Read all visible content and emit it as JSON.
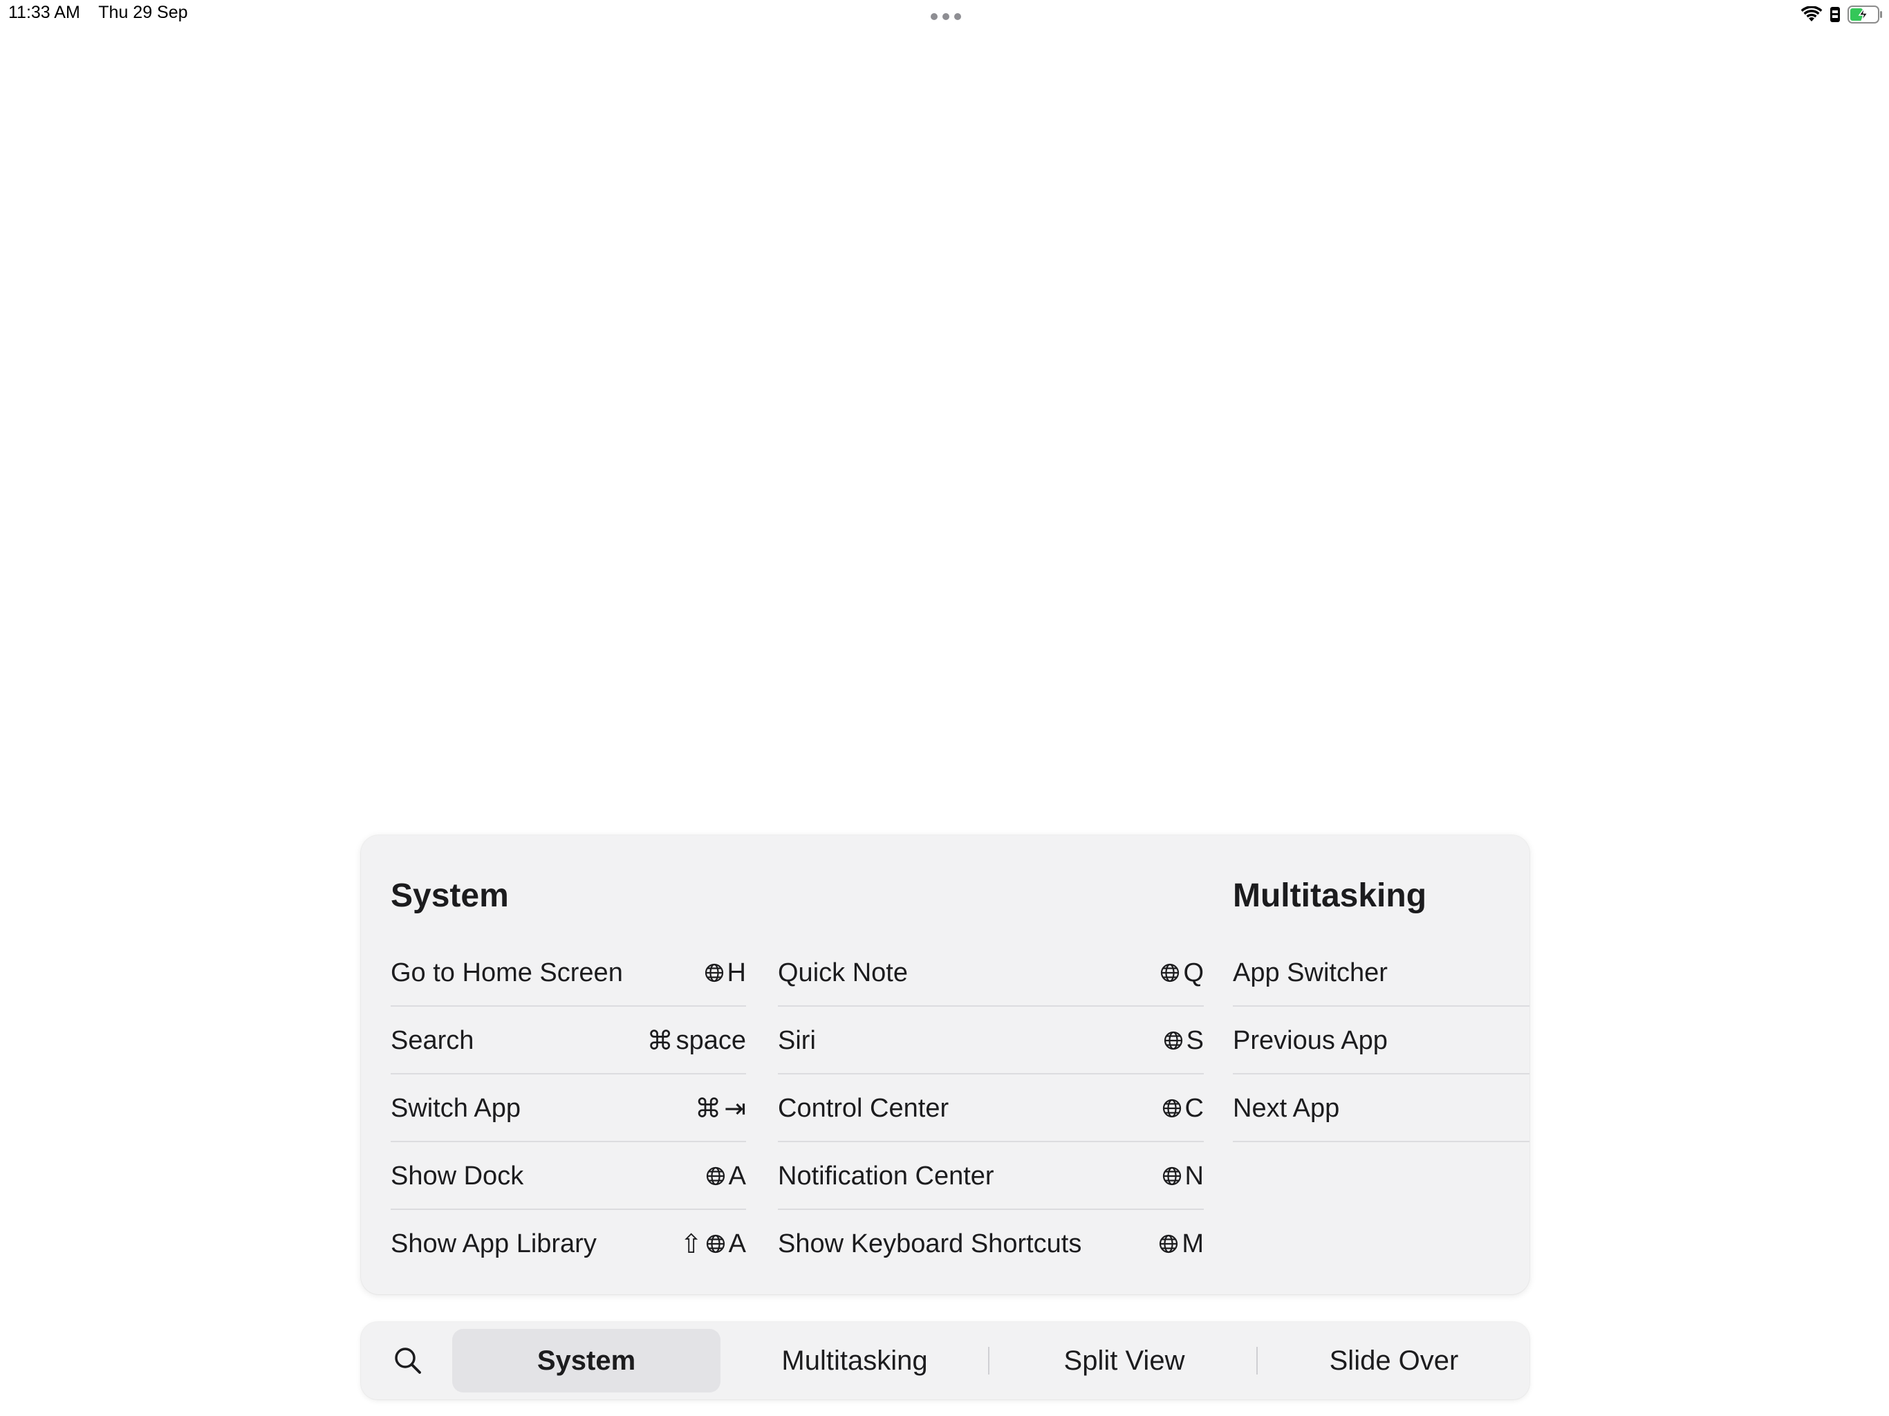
{
  "status_bar": {
    "time": "11:33 AM",
    "date": "Thu 29 Sep",
    "icons": [
      "wifi-icon",
      "sim-icon",
      "battery-charging-icon"
    ],
    "battery_color": "#34c759"
  },
  "panel": {
    "system": {
      "title": "System",
      "col1": [
        {
          "label": "Go to Home Screen",
          "modifiers": [
            "globe"
          ],
          "key": "H"
        },
        {
          "label": "Search",
          "modifiers": [
            "command"
          ],
          "key": "space"
        },
        {
          "label": "Switch App",
          "modifiers": [
            "command"
          ],
          "key": "⇥"
        },
        {
          "label": "Show Dock",
          "modifiers": [
            "globe"
          ],
          "key": "A"
        },
        {
          "label": "Show App Library",
          "modifiers": [
            "shift",
            "globe"
          ],
          "key": "A"
        }
      ],
      "col2": [
        {
          "label": "Quick Note",
          "modifiers": [
            "globe"
          ],
          "key": "Q"
        },
        {
          "label": "Siri",
          "modifiers": [
            "globe"
          ],
          "key": "S"
        },
        {
          "label": "Control Center",
          "modifiers": [
            "globe"
          ],
          "key": "C"
        },
        {
          "label": "Notification Center",
          "modifiers": [
            "globe"
          ],
          "key": "N"
        },
        {
          "label": "Show Keyboard Shortcuts",
          "modifiers": [
            "globe"
          ],
          "key": "M"
        }
      ]
    },
    "multitasking": {
      "title": "Multitasking",
      "items": [
        {
          "label": "App Switcher"
        },
        {
          "label": "Previous App"
        },
        {
          "label": "Next App"
        }
      ]
    }
  },
  "tabbar": {
    "tabs": [
      {
        "label": "System",
        "selected": true
      },
      {
        "label": "Multitasking",
        "selected": false
      },
      {
        "label": "Split View",
        "selected": false
      },
      {
        "label": "Slide Over",
        "selected": false
      }
    ]
  },
  "glyphs": {
    "command": "⌘",
    "shift": "⇧"
  }
}
